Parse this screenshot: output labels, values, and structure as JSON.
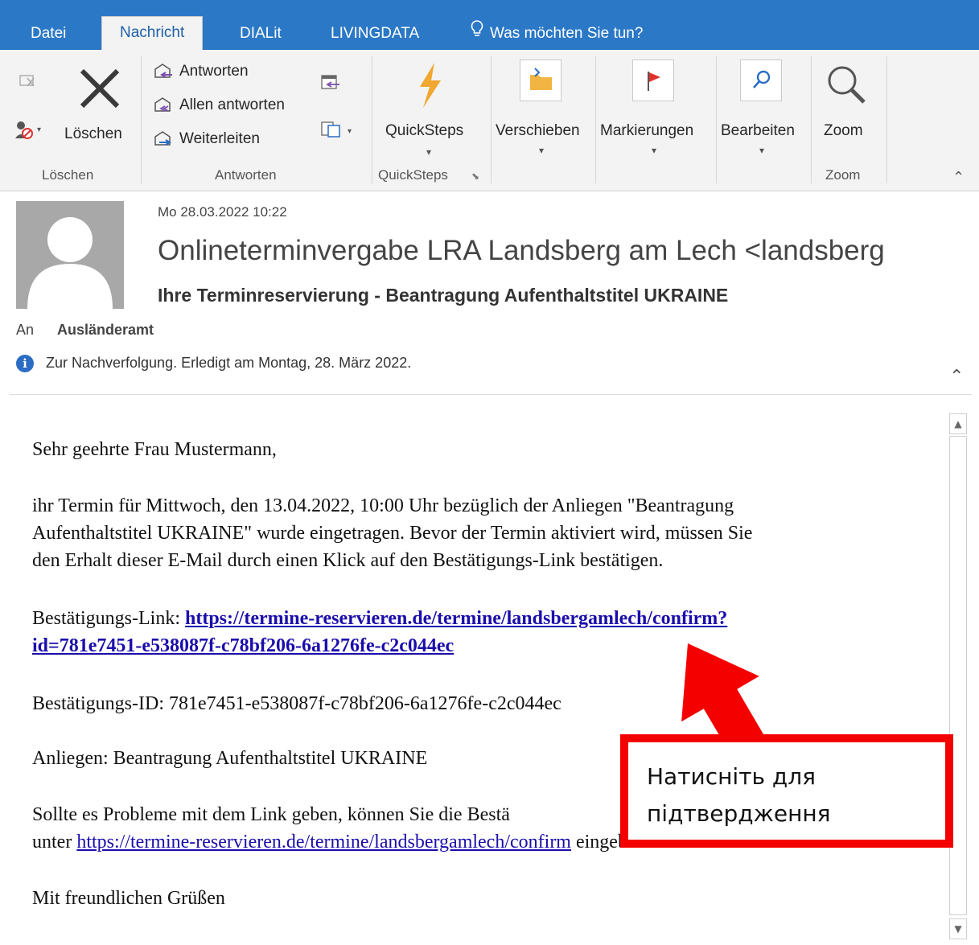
{
  "tabs": [
    {
      "label": "Datei",
      "active": false
    },
    {
      "label": "Nachricht",
      "active": true
    },
    {
      "label": "DIALit",
      "active": false
    },
    {
      "label": "LIVINGDATA",
      "active": false
    }
  ],
  "tell_me": "Was möchten Sie tun?",
  "ribbon": {
    "delete_label": "Löschen",
    "delete_group": "Löschen",
    "reply": "Antworten",
    "reply_all": "Allen antworten",
    "forward": "Weiterleiten",
    "respond_group": "Antworten",
    "quicksteps": "QuickSteps",
    "quicksteps_group": "QuickSteps",
    "move": "Verschieben",
    "tags": "Markierungen",
    "editing": "Bearbeiten",
    "zoom": "Zoom",
    "zoom_group": "Zoom"
  },
  "message": {
    "date": "Mo 28.03.2022 10:22",
    "sender": "Onlineterminvergabe LRA Landsberg am Lech <landsberg",
    "subject": "Ihre Terminreservierung - Beantragung Aufenthaltstitel UKRAINE",
    "to_label": "An",
    "to_value": "Ausländeramt",
    "info": "Zur Nachverfolgung.  Erledigt am Montag, 28. März 2022."
  },
  "body": {
    "greeting": "Sehr geehrte Frau Mustermann,",
    "para1_line1": "ihr Termin für Mittwoch, den 13.04.2022, 10:00 Uhr bezüglich der Anliegen \"Beantragung",
    "para1_line2": "Aufenthaltstitel UKRAINE\" wurde eingetragen. Bevor der Termin aktiviert wird, müssen Sie",
    "para1_line3": "den Erhalt dieser E-Mail durch einen Klick auf den Bestätigungs-Link bestätigen.",
    "link_label": "Bestätigungs-Link: ",
    "link_line1": "https://termine-reservieren.de/termine/landsbergamlech/confirm?",
    "link_line2": "id=781e7451-e538087f-c78bf206-6a1276fe-c2c044ec",
    "confirm_id": "Bestätigungs-ID: 781e7451-e538087f-c78bf206-6a1276fe-c2c044ec",
    "concern": "Anliegen: Beantragung Aufenthaltstitel UKRAINE",
    "problem_line1": "Sollte es Probleme mit dem Link geben, können Sie die Bestä",
    "problem_line2_prefix": "unter ",
    "problem_link": "https://termine-reservieren.de/termine/landsbergamlech/confirm",
    "problem_line2_suffix": " eingeben.",
    "closing": "Mit freundlichen Grüßen"
  },
  "callout": {
    "line1": "Натисніть для",
    "line2": "підтвердження",
    "color": "#f40000"
  }
}
